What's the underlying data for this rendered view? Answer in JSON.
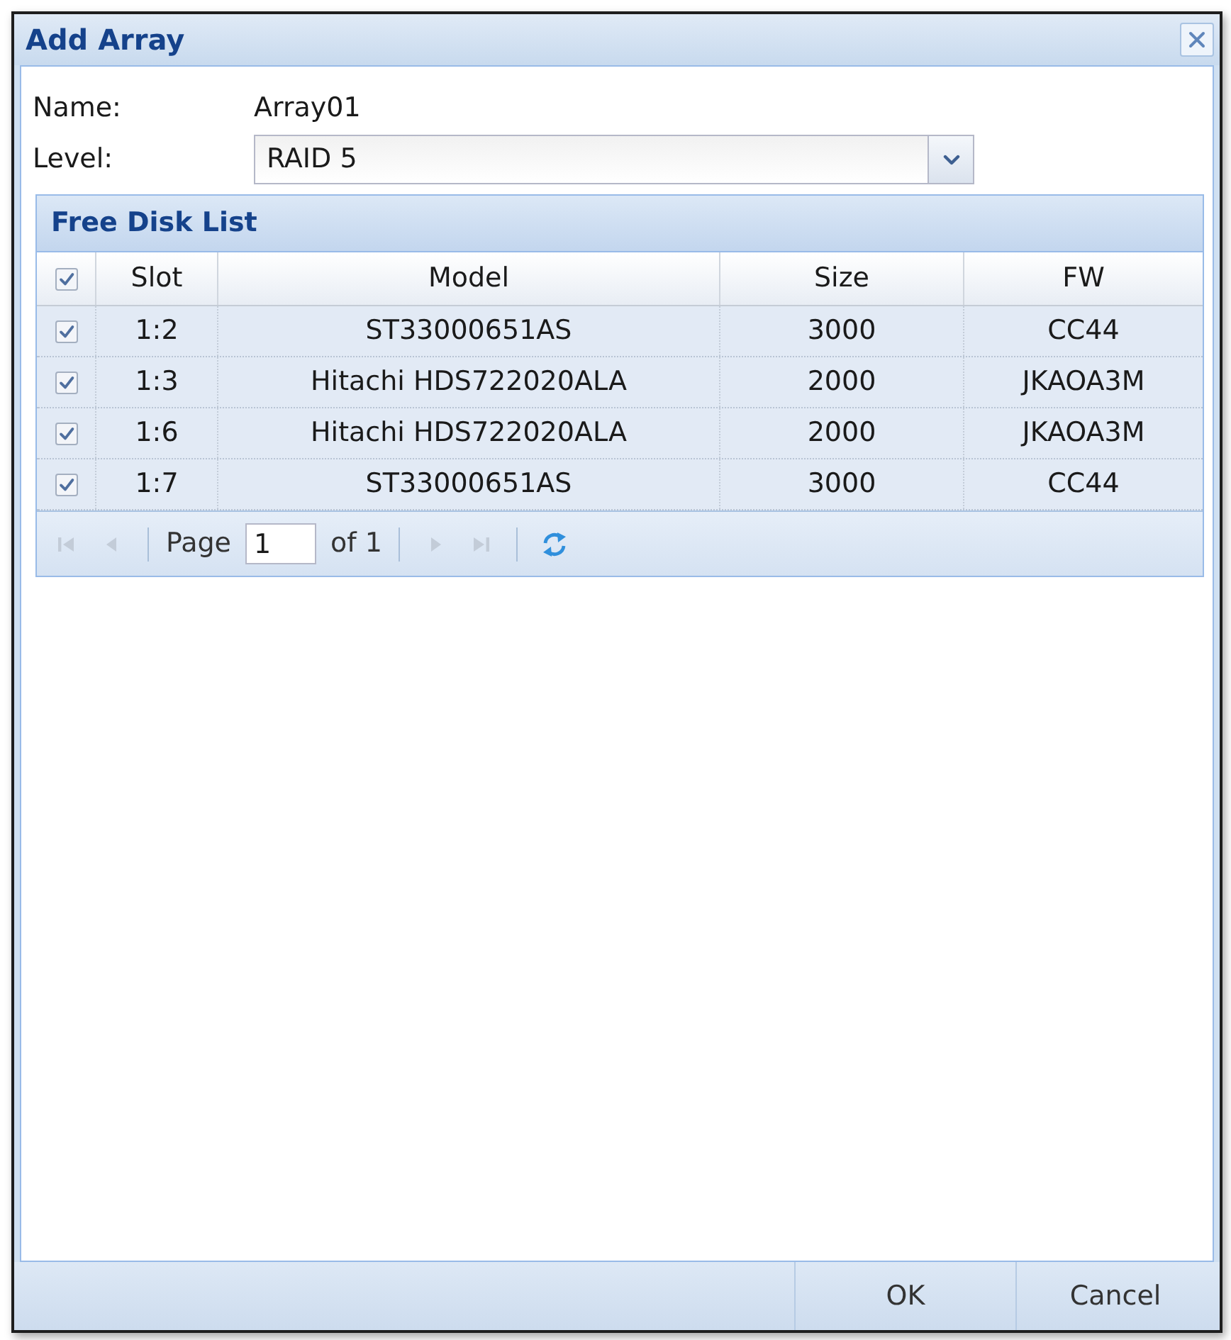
{
  "window": {
    "title": "Add Array"
  },
  "form": {
    "name_label": "Name:",
    "name_value": "Array01",
    "level_label": "Level:",
    "level_value": "RAID 5"
  },
  "disk_list": {
    "title": "Free Disk List",
    "all_checked": true,
    "columns": [
      "Slot",
      "Model",
      "Size",
      "FW"
    ],
    "rows": [
      {
        "checked": true,
        "cells": [
          "1:2",
          "ST33000651AS",
          "3000",
          "CC44"
        ]
      },
      {
        "checked": true,
        "cells": [
          "1:3",
          "Hitachi HDS722020ALA",
          "2000",
          "JKAOA3M"
        ]
      },
      {
        "checked": true,
        "cells": [
          "1:6",
          "Hitachi HDS722020ALA",
          "2000",
          "JKAOA3M"
        ]
      },
      {
        "checked": true,
        "cells": [
          "1:7",
          "ST33000651AS",
          "3000",
          "CC44"
        ]
      }
    ]
  },
  "pager": {
    "items": [
      {
        "kind": "first",
        "disabled": true
      },
      {
        "kind": "prev",
        "disabled": true
      },
      {
        "kind": "separator"
      },
      {
        "kind": "label",
        "text": "Page"
      },
      {
        "kind": "input",
        "value": "1"
      },
      {
        "kind": "label",
        "text": "of 1"
      },
      {
        "kind": "separator"
      },
      {
        "kind": "next",
        "disabled": true
      },
      {
        "kind": "last",
        "disabled": true
      },
      {
        "kind": "separator"
      },
      {
        "kind": "refresh",
        "disabled": false
      }
    ]
  },
  "buttons": [
    "OK",
    "Cancel"
  ]
}
